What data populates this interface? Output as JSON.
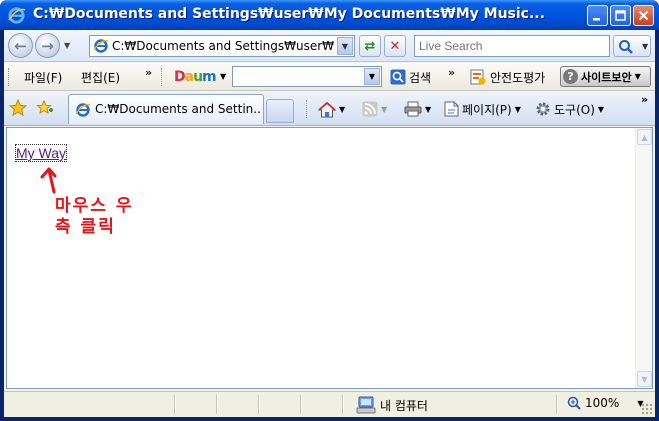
{
  "window": {
    "title": "C:₩Documents and Settings₩user₩My Documents₩My Music..."
  },
  "address_bar": {
    "url": "C:₩Documents and Settings₩user₩My Documents₩My Music",
    "search_placeholder": "Live Search"
  },
  "menu": {
    "file": "파일(F)",
    "edit": "편집(E)",
    "more": "»"
  },
  "daum_toolbar": {
    "logo": "Daum",
    "search_label": "검색",
    "safety_label": "안전도평가",
    "siteguard_label": "사이트보안"
  },
  "tabs": {
    "active_label": "C:₩Documents and Settin..."
  },
  "commands": {
    "page_label": "페이지(P)",
    "tools_label": "도구(O)",
    "more": "»"
  },
  "page": {
    "link_text": "My Way",
    "annotation_line1": "마우스 우",
    "annotation_line2": "측 클릭"
  },
  "status_bar": {
    "zone": "내 컴퓨터",
    "zoom": "100%"
  },
  "colors": {
    "titlebar": "#0054e3",
    "annotation": "#e0161b",
    "link_visited": "#551a8b"
  }
}
